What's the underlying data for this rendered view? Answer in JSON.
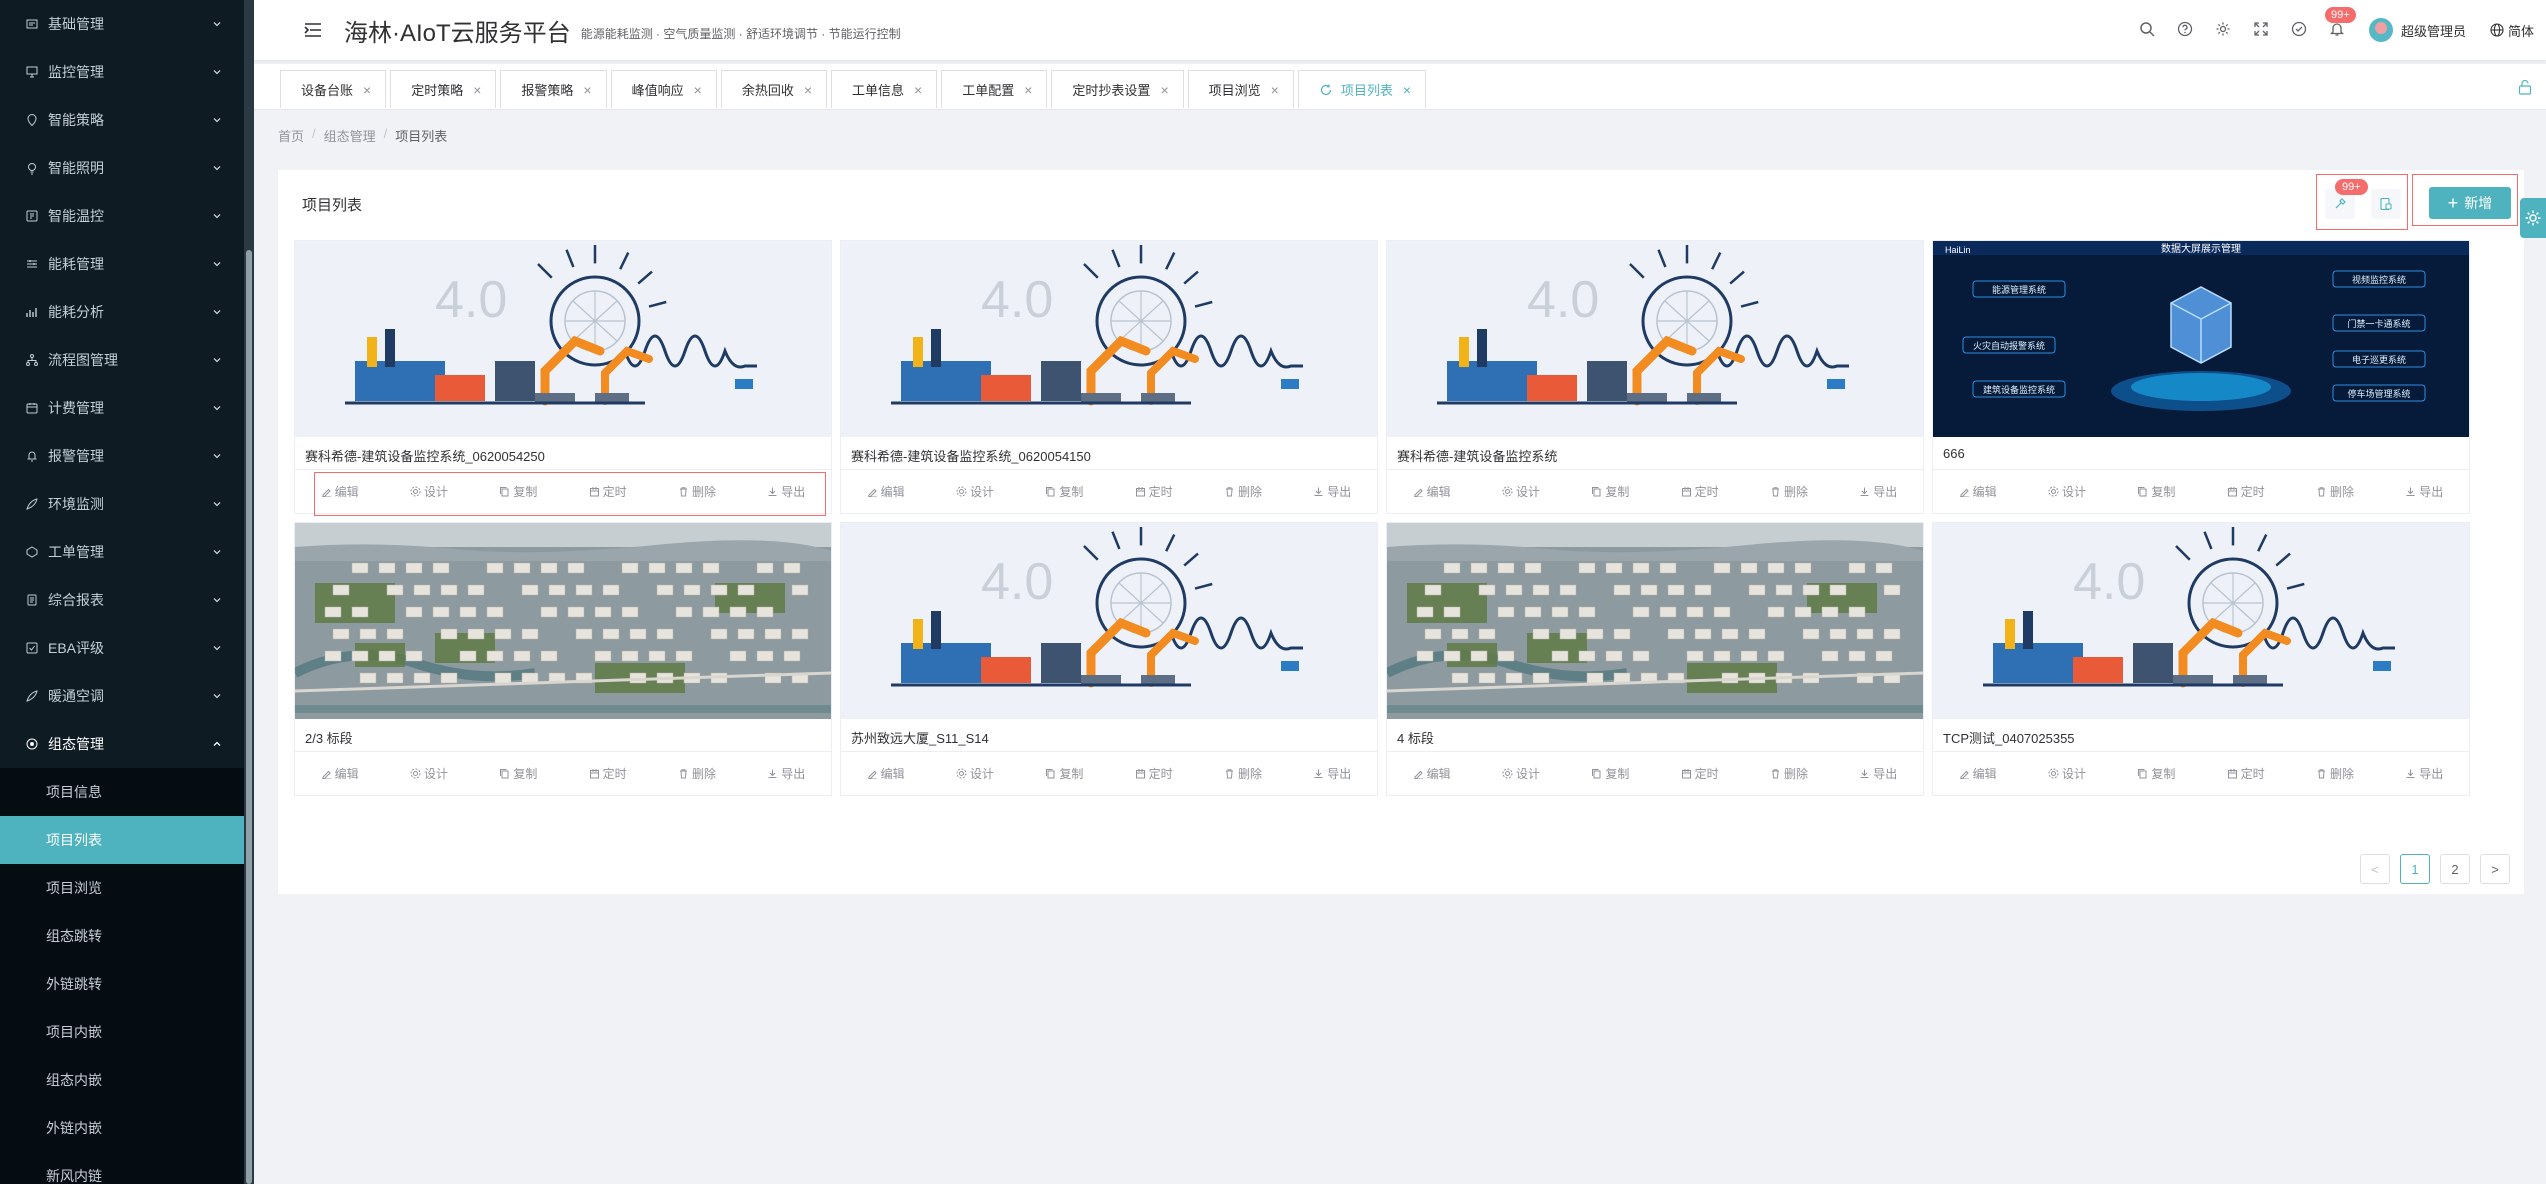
{
  "app": {
    "title": "海林·AIoT云服务平台",
    "subtitle": "能源能耗监测 · 空气质量监测 · 舒适环境调节 · 节能运行控制"
  },
  "header": {
    "notif_badge": "99+",
    "user_name": "超级管理员",
    "lang": "简体"
  },
  "sidebar": {
    "items": [
      {
        "label": "基础管理"
      },
      {
        "label": "监控管理"
      },
      {
        "label": "智能策略"
      },
      {
        "label": "智能照明"
      },
      {
        "label": "智能温控"
      },
      {
        "label": "能耗管理"
      },
      {
        "label": "能耗分析"
      },
      {
        "label": "流程图管理"
      },
      {
        "label": "计费管理"
      },
      {
        "label": "报警管理"
      },
      {
        "label": "环境监测"
      },
      {
        "label": "工单管理"
      },
      {
        "label": "综合报表"
      },
      {
        "label": "EBA评级"
      },
      {
        "label": "暖通空调"
      },
      {
        "label": "组态管理"
      }
    ],
    "submenu": [
      {
        "label": "项目信息"
      },
      {
        "label": "项目列表"
      },
      {
        "label": "项目浏览"
      },
      {
        "label": "组态跳转"
      },
      {
        "label": "外链跳转"
      },
      {
        "label": "项目内嵌"
      },
      {
        "label": "组态内嵌"
      },
      {
        "label": "外链内嵌"
      },
      {
        "label": "新风内链"
      }
    ]
  },
  "tabs": [
    {
      "label": "设备台账"
    },
    {
      "label": "定时策略"
    },
    {
      "label": "报警策略"
    },
    {
      "label": "峰值响应"
    },
    {
      "label": "余热回收"
    },
    {
      "label": "工单信息"
    },
    {
      "label": "工单配置"
    },
    {
      "label": "定时抄表设置"
    },
    {
      "label": "项目浏览"
    },
    {
      "label": "项目列表"
    }
  ],
  "tab_close": "×",
  "breadcrumb": {
    "home": "首页",
    "sep": "/",
    "parent": "组态管理",
    "current": "项目列表"
  },
  "card": {
    "title": "项目列表",
    "badge": "99+",
    "add_label": "新增"
  },
  "projects": [
    {
      "name": "赛科希德-建筑设备监控系统_0620054250",
      "thumb": "industry-4.0"
    },
    {
      "name": "赛科希德-建筑设备监控系统_0620054150",
      "thumb": "industry-4.0"
    },
    {
      "name": "赛科希德-建筑设备监控系统",
      "thumb": "industry-4.0"
    },
    {
      "name": "666",
      "thumb": "dashboard-screen"
    },
    {
      "name": "2/3 标段",
      "thumb": "aerial-city"
    },
    {
      "name": "苏州致远大厦_S11_S14",
      "thumb": "industry-4.0"
    },
    {
      "name": "4 标段",
      "thumb": "aerial-city"
    },
    {
      "name": "TCP测试_0407025355",
      "thumb": "industry-4.0"
    }
  ],
  "actions": {
    "edit": "编辑",
    "design": "设计",
    "copy": "复制",
    "schedule": "定时",
    "delete": "删除",
    "export": "导出"
  },
  "pagination": {
    "prev": "<",
    "pages": [
      "1",
      "2"
    ],
    "next": ">",
    "current": "1"
  },
  "thumb_text": {
    "industry_label": "4.0",
    "dashboard": {
      "logo": "HaiLin",
      "title": "数据大屏展示管理",
      "left": [
        "能源管理系统",
        "火灾自动报警系统",
        "建筑设备监控系统"
      ],
      "right": [
        "视频监控系统",
        "门禁一卡通系统",
        "电子巡更系统",
        "停车场管理系统"
      ]
    }
  },
  "colors": {
    "accent": "#4fb3bf",
    "sidebar_bg": "#0e1b23",
    "danger": "#f56c6c"
  }
}
